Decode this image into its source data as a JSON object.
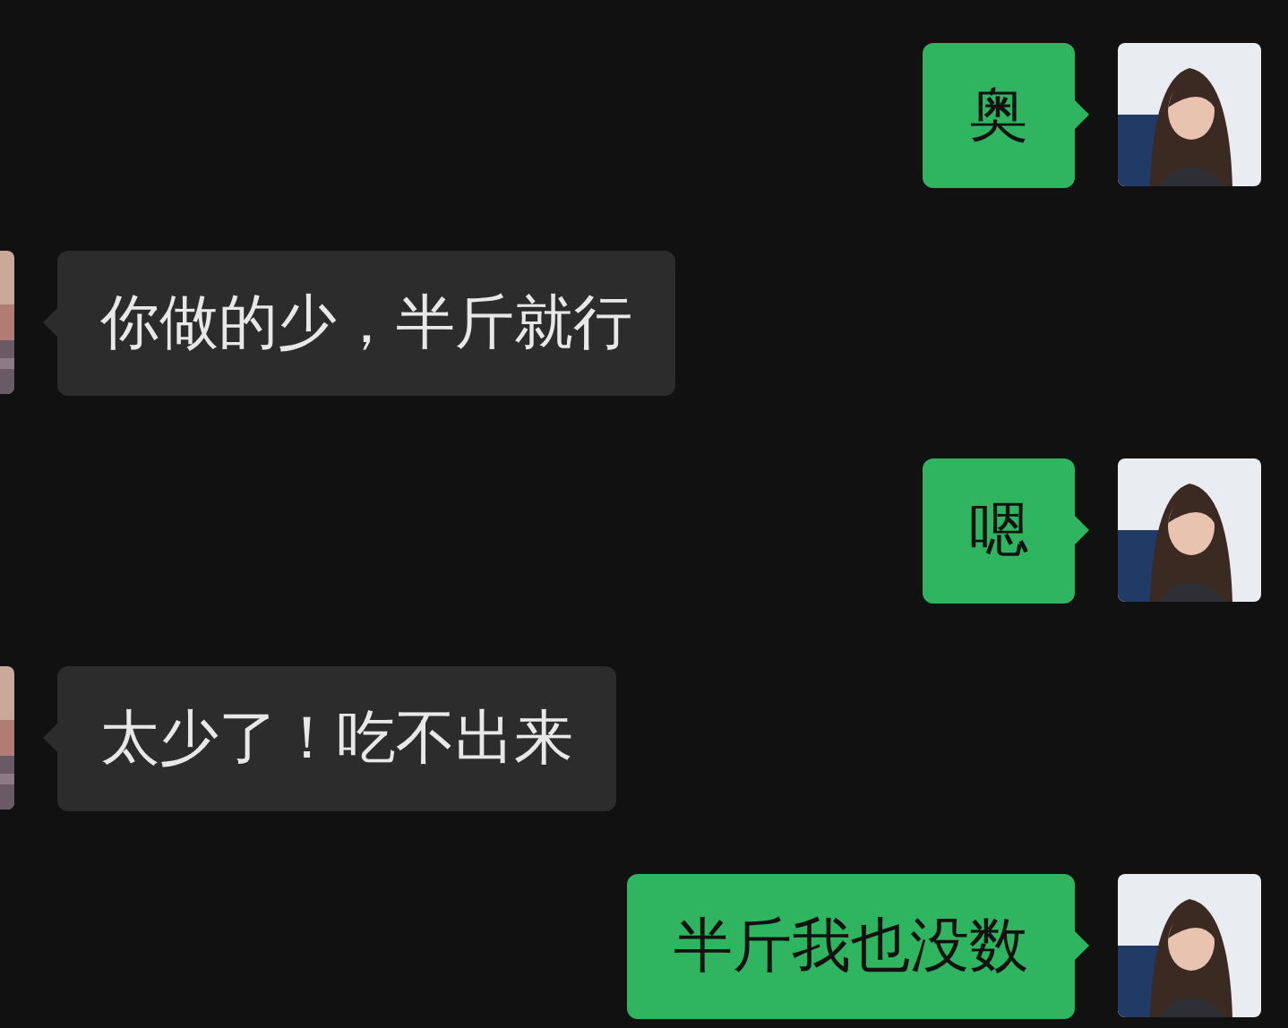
{
  "messages": [
    {
      "kind": "sent",
      "text": "奥"
    },
    {
      "kind": "received",
      "text": "你做的少，半斤就行"
    },
    {
      "kind": "sent",
      "text": "嗯"
    },
    {
      "kind": "received",
      "text": "太少了！吃不出来"
    },
    {
      "kind": "sent",
      "text": "半斤我也没数"
    }
  ]
}
